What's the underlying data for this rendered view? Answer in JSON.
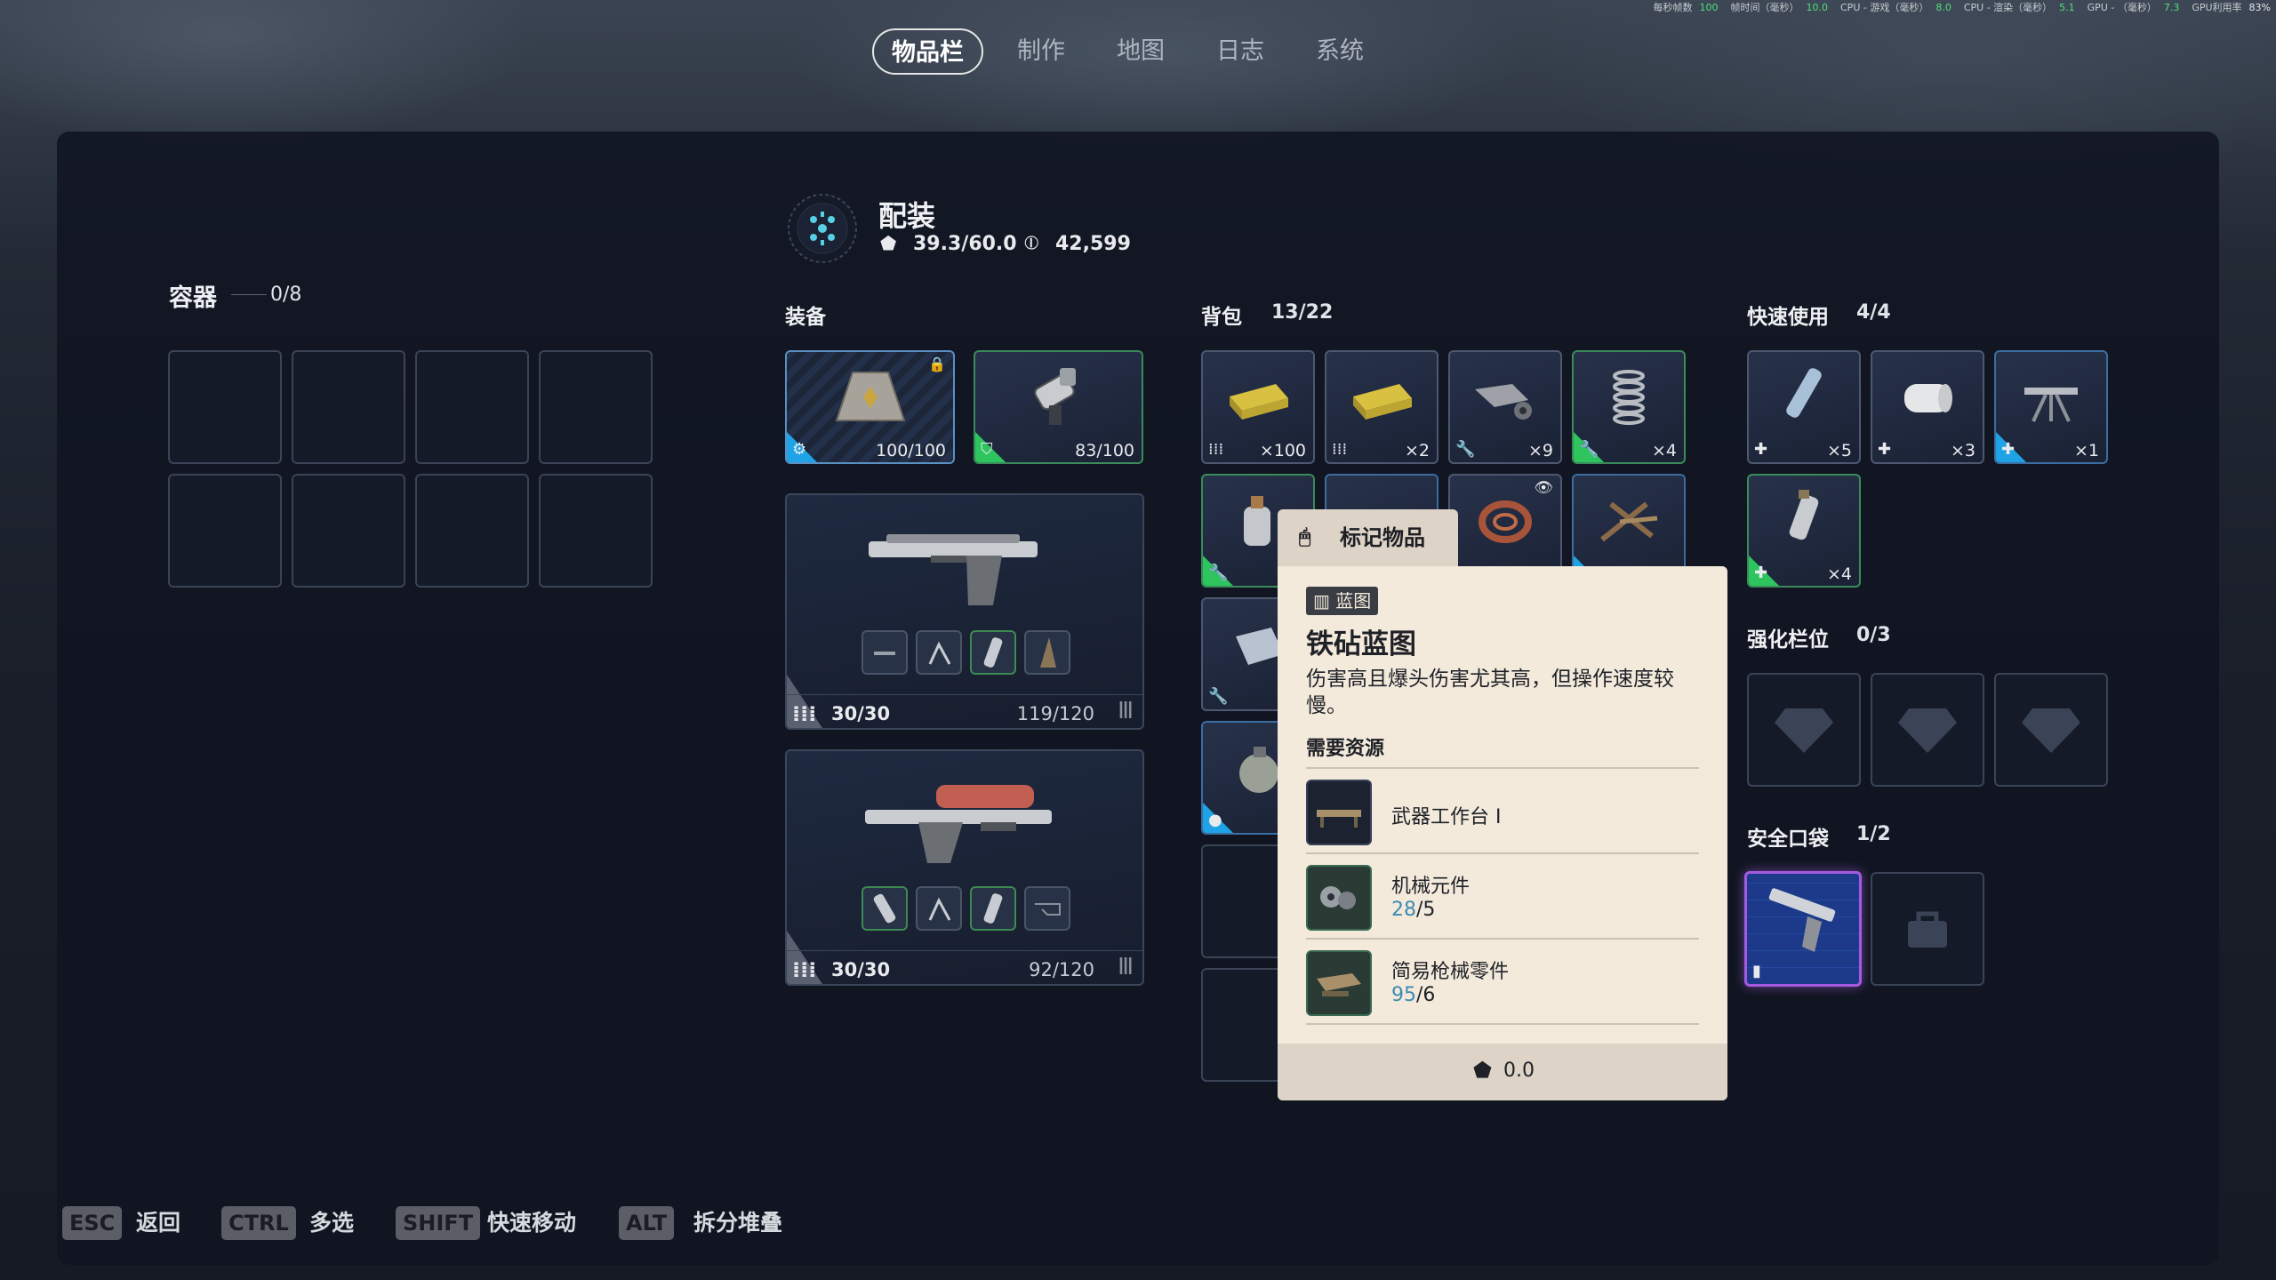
{
  "perf_overlay": [
    {
      "label": "每秒帧数",
      "value": "100"
    },
    {
      "label": "帧时间（毫秒）",
      "value": "10.0"
    },
    {
      "label": "CPU - 游戏（毫秒）",
      "value": "8.0"
    },
    {
      "label": "CPU - 渲染（毫秒）",
      "value": "5.1"
    },
    {
      "label": "GPU - （毫秒）",
      "value": "7.3"
    },
    {
      "label": "GPU利用率",
      "value": "83%"
    }
  ],
  "tabs": [
    {
      "label": "物品栏",
      "active": true
    },
    {
      "label": "制作"
    },
    {
      "label": "地图"
    },
    {
      "label": "日志"
    },
    {
      "label": "系统"
    }
  ],
  "container": {
    "title": "容器",
    "count": "0/8"
  },
  "loadout": {
    "title": "配装",
    "weight": "39.3/60.0",
    "currency": "42,599"
  },
  "equipment": {
    "title": "装备",
    "augment_value": "100/100",
    "shield_value": "83/100",
    "weapon1": {
      "mag": "30/30",
      "reserve": "119/120"
    },
    "weapon2": {
      "mag": "30/30",
      "reserve": "92/120"
    }
  },
  "backpack": {
    "title": "背包",
    "count": "13/22",
    "qty": [
      "×100",
      "×2",
      "×9",
      "×4"
    ]
  },
  "quick_use": {
    "title": "快速使用",
    "count": "4/4",
    "qty": [
      "×5",
      "×3",
      "×1",
      "×4"
    ]
  },
  "augment_slots": {
    "title": "强化栏位",
    "count": "0/3"
  },
  "safe_pocket": {
    "title": "安全口袋",
    "count": "1/2"
  },
  "tooltip": {
    "mark_label": "标记物品",
    "category": "蓝图",
    "name": "铁砧蓝图",
    "description": "伤害高且爆头伤害尤其高，但操作速度较慢。",
    "resources_title": "需要资源",
    "resources": [
      {
        "name": "武器工作台 I",
        "have": "",
        "need": ""
      },
      {
        "name": "机械元件",
        "have": "28",
        "need": "/5"
      },
      {
        "name": "简易枪械零件",
        "have": "95",
        "need": "/6"
      }
    ],
    "weight": "0.0"
  },
  "hotkeys": [
    {
      "key": "ESC",
      "label": "返回"
    },
    {
      "key": "CTRL",
      "label": "多选"
    },
    {
      "key": "SHIFT",
      "label": "快速移动"
    },
    {
      "key": "ALT",
      "label": "拆分堆叠"
    }
  ]
}
